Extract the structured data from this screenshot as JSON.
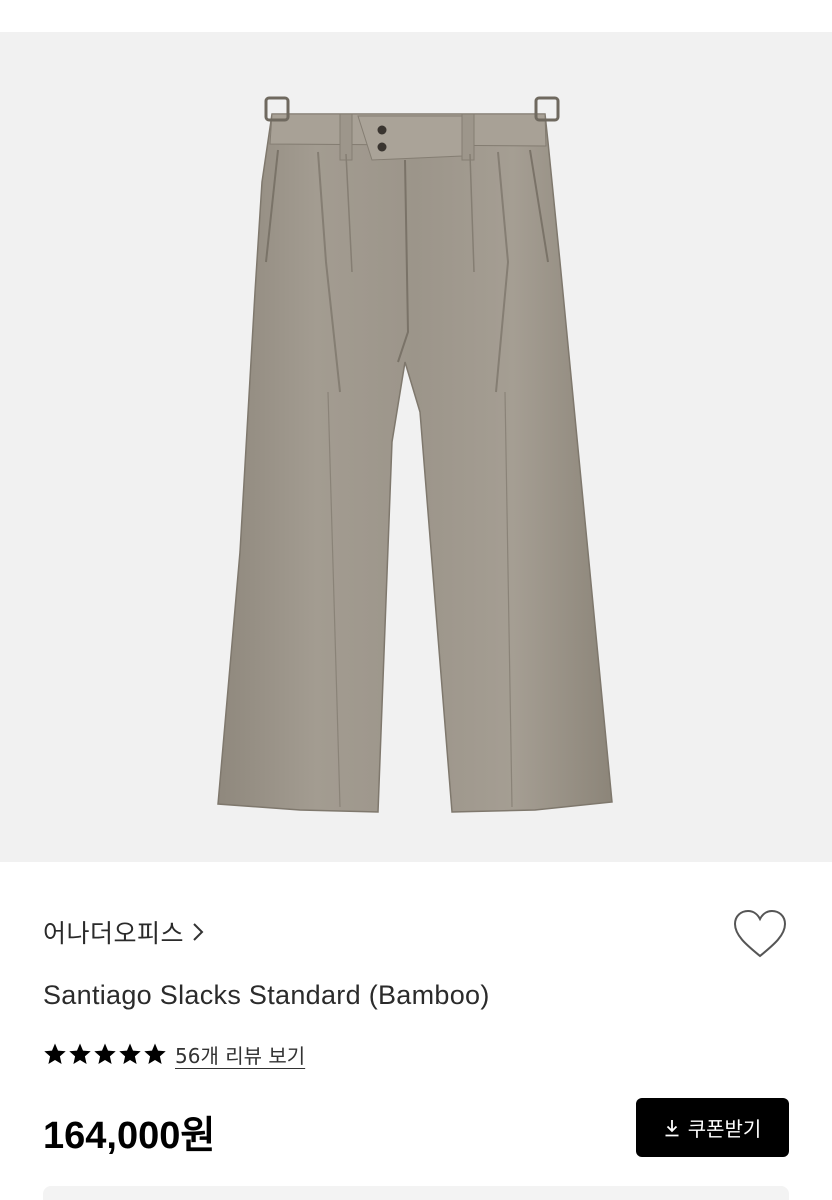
{
  "product": {
    "image_name": "grey-pleated-wide-slacks",
    "brand": "어나더오피스",
    "title": "Santiago Slacks Standard (Bamboo)",
    "rating": 5,
    "review_link": "56개 리뷰 보기",
    "price": "164,000원"
  },
  "actions": {
    "coupon_label": "쿠폰받기",
    "wish_icon": "heart-outline-icon",
    "download_icon": "download-icon"
  },
  "colors": {
    "image_background": "#f1f1f1",
    "pants": "#a19a8f",
    "button": "#000000",
    "star": "#000000"
  }
}
